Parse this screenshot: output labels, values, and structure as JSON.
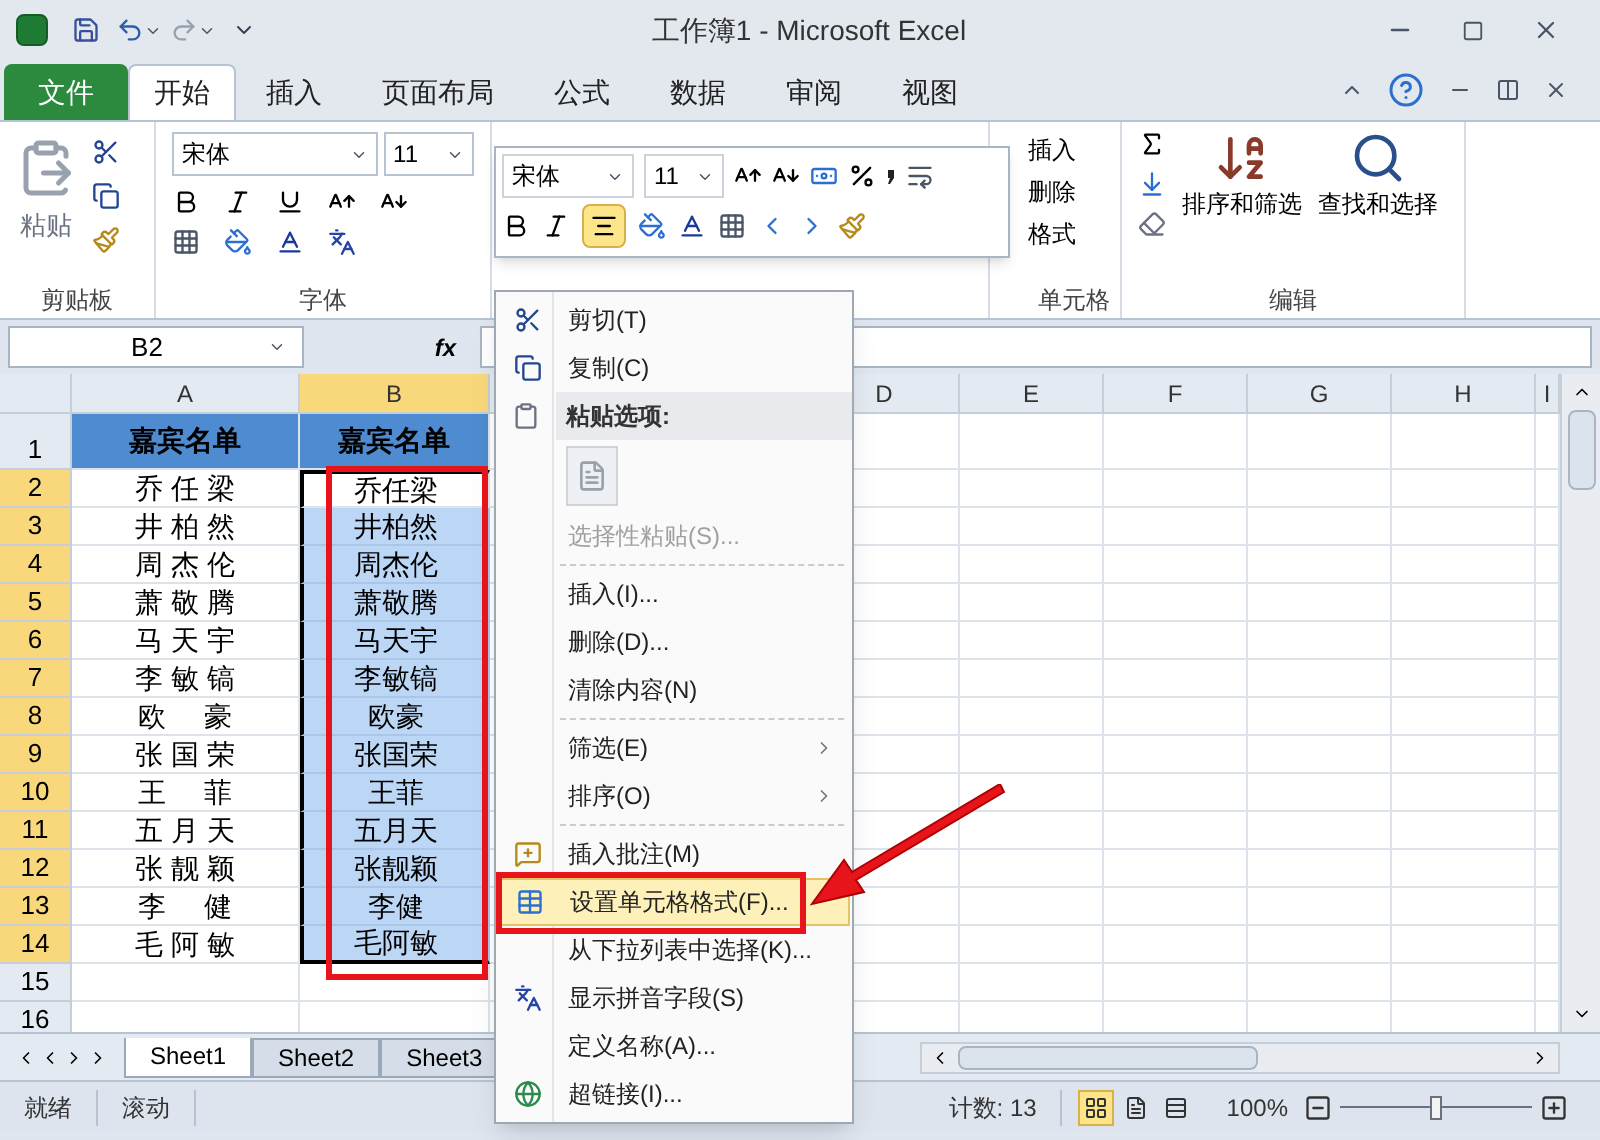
{
  "title_bar": {
    "title": "工作簿1 - Microsoft Excel"
  },
  "ribbon_tabs": [
    {
      "label": "文件",
      "kind": "file"
    },
    {
      "label": "开始",
      "kind": "tab",
      "selected": true
    },
    {
      "label": "插入",
      "kind": "tab",
      "selected": false
    },
    {
      "label": "页面布局",
      "kind": "tab",
      "selected": false
    },
    {
      "label": "公式",
      "kind": "tab",
      "selected": false
    },
    {
      "label": "数据",
      "kind": "tab",
      "selected": false
    },
    {
      "label": "审阅",
      "kind": "tab",
      "selected": false
    },
    {
      "label": "视图",
      "kind": "tab",
      "selected": false
    }
  ],
  "ribbon": {
    "clipboard": {
      "paste_label": "粘贴",
      "group_label": "剪贴板"
    },
    "font": {
      "font_name": "宋体",
      "font_size": "11",
      "group_label": "字体"
    },
    "cells": {
      "items": [
        "插入",
        "删除",
        "格式"
      ],
      "group_label": "单元格"
    },
    "editing": {
      "sort_filter": "排序和筛选",
      "find_select": "查找和选择",
      "group_label": "编辑"
    }
  },
  "mini_toolbar": {
    "font_name": "宋体",
    "font_size": "11",
    "center_align_selected": true
  },
  "formula_bar": {
    "name_box": "B2",
    "function_label": "fx"
  },
  "columns": [
    "A",
    "B",
    "D",
    "E",
    "F",
    "G",
    "H",
    "I"
  ],
  "rows": [
    {
      "header": "1",
      "a": "嘉宾名单",
      "b": "嘉宾名单",
      "kind": "title",
      "selected": false,
      "active": false
    },
    {
      "header": "2",
      "a": "乔 任 梁",
      "b": "乔任梁",
      "kind": "name",
      "selected": true,
      "active": true
    },
    {
      "header": "3",
      "a": "井 柏 然",
      "b": "井柏然",
      "kind": "name",
      "selected": true,
      "active": false
    },
    {
      "header": "4",
      "a": "周 杰 伦",
      "b": "周杰伦",
      "kind": "name",
      "selected": true,
      "active": false
    },
    {
      "header": "5",
      "a": "萧 敬 腾",
      "b": "萧敬腾",
      "kind": "name",
      "selected": true,
      "active": false
    },
    {
      "header": "6",
      "a": "马 天 宇",
      "b": "马天宇",
      "kind": "name",
      "selected": true,
      "active": false
    },
    {
      "header": "7",
      "a": "李 敏 镐",
      "b": "李敏镐",
      "kind": "name",
      "selected": true,
      "active": false
    },
    {
      "header": "8",
      "a": "欧     豪",
      "b": "欧豪",
      "kind": "name",
      "selected": true,
      "active": false
    },
    {
      "header": "9",
      "a": "张 国 荣",
      "b": "张国荣",
      "kind": "name",
      "selected": true,
      "active": false
    },
    {
      "header": "10",
      "a": "王     菲",
      "b": "王菲",
      "kind": "name",
      "selected": true,
      "active": false
    },
    {
      "header": "11",
      "a": "五 月 天",
      "b": "五月天",
      "kind": "name",
      "selected": true,
      "active": false
    },
    {
      "header": "12",
      "a": "张 靓 颖",
      "b": "张靓颖",
      "kind": "name",
      "selected": true,
      "active": false
    },
    {
      "header": "13",
      "a": "李     健",
      "b": "李健",
      "kind": "name",
      "selected": true,
      "active": false
    },
    {
      "header": "14",
      "a": "毛 阿 敏",
      "b": "毛阿敏",
      "kind": "name",
      "selected": true,
      "active": false
    },
    {
      "header": "15",
      "kind": "empty",
      "selected": false,
      "active": false
    },
    {
      "header": "16",
      "kind": "empty",
      "selected": false,
      "active": false
    }
  ],
  "context_menu": [
    {
      "kind": "item",
      "label": "剪切(T)",
      "disabled": false,
      "submenu": false,
      "selected": false
    },
    {
      "kind": "item",
      "label": "复制(C)",
      "disabled": false,
      "submenu": false,
      "selected": false
    },
    {
      "kind": "header",
      "label": "粘贴选项:"
    },
    {
      "kind": "paste_option"
    },
    {
      "kind": "item",
      "label": "选择性粘贴(S)...",
      "disabled": true,
      "submenu": false,
      "selected": false
    },
    {
      "kind": "separator"
    },
    {
      "kind": "item",
      "label": "插入(I)...",
      "disabled": false,
      "submenu": false,
      "selected": false
    },
    {
      "kind": "item",
      "label": "删除(D)...",
      "disabled": false,
      "submenu": false,
      "selected": false
    },
    {
      "kind": "item",
      "label": "清除内容(N)",
      "disabled": false,
      "submenu": false,
      "selected": false
    },
    {
      "kind": "separator"
    },
    {
      "kind": "item",
      "label": "筛选(E)",
      "disabled": false,
      "submenu": true,
      "selected": false
    },
    {
      "kind": "item",
      "label": "排序(O)",
      "disabled": false,
      "submenu": true,
      "selected": false
    },
    {
      "kind": "separator"
    },
    {
      "kind": "item",
      "label": "插入批注(M)",
      "disabled": false,
      "submenu": false,
      "selected": false
    },
    {
      "kind": "item",
      "label": "设置单元格格式(F)...",
      "disabled": false,
      "submenu": false,
      "selected": true
    },
    {
      "kind": "item",
      "label": "从下拉列表中选择(K)...",
      "disabled": false,
      "submenu": false,
      "selected": false
    },
    {
      "kind": "item",
      "label": "显示拼音字段(S)",
      "disabled": false,
      "submenu": false,
      "selected": false
    },
    {
      "kind": "item",
      "label": "定义名称(A)...",
      "disabled": false,
      "submenu": false,
      "selected": false
    },
    {
      "kind": "item",
      "label": "超链接(I)...",
      "disabled": false,
      "submenu": false,
      "selected": false
    }
  ],
  "sheet_tabs": [
    {
      "label": "Sheet1",
      "selected": true
    },
    {
      "label": "Sheet2",
      "selected": false
    },
    {
      "label": "Sheet3",
      "selected": false
    }
  ],
  "status_bar": {
    "items": [
      "就绪",
      "滚动"
    ],
    "count": "计数: 13",
    "views": [
      {
        "kind": "normal",
        "selected": true
      },
      {
        "kind": "page_layout",
        "selected": false
      },
      {
        "kind": "page_break",
        "selected": false
      }
    ],
    "zoom": "100%",
    "zoom_slider": {
      "level": 0.5
    }
  }
}
